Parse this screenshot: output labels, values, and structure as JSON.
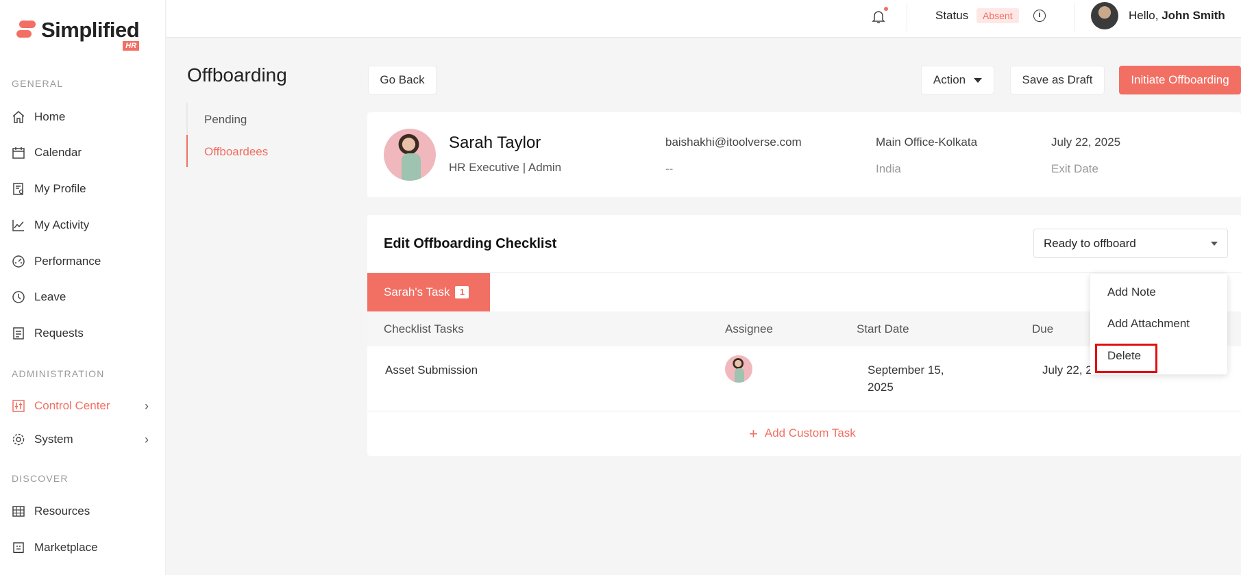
{
  "brand": {
    "name": "Simplified",
    "badge": "HR"
  },
  "sidebar": {
    "sections": {
      "general": "GENERAL",
      "administration": "ADMINISTRATION",
      "discover": "DISCOVER"
    },
    "items": [
      {
        "label": "Home",
        "icon": "home-icon"
      },
      {
        "label": "Calendar",
        "icon": "calendar-icon"
      },
      {
        "label": "My Profile",
        "icon": "profile-icon"
      },
      {
        "label": "My Activity",
        "icon": "activity-chart-icon"
      },
      {
        "label": "Performance",
        "icon": "gauge-icon"
      },
      {
        "label": "Leave",
        "icon": "clock-icon"
      },
      {
        "label": "Requests",
        "icon": "requests-icon"
      },
      {
        "label": "Control Center",
        "icon": "sliders-icon"
      },
      {
        "label": "System",
        "icon": "gear-icon"
      },
      {
        "label": "Resources",
        "icon": "table-icon"
      },
      {
        "label": "Marketplace",
        "icon": "store-icon"
      }
    ]
  },
  "header": {
    "status_label": "Status",
    "status_value": "Absent",
    "greeting": "Hello,",
    "user_name": "John Smith"
  },
  "page": {
    "title": "Offboarding",
    "subnav": [
      "Pending",
      "Offboardees"
    ]
  },
  "actions": {
    "go_back": "Go Back",
    "action": "Action",
    "save_draft": "Save as Draft",
    "initiate": "Initiate Offboarding"
  },
  "employee": {
    "name": "Sarah Taylor",
    "role": "HR Executive | Admin",
    "email": "baishakhi@itoolverse.com",
    "phone": "--",
    "office": "Main Office-Kolkata",
    "country": "India",
    "exit_date": "July 22, 2025",
    "exit_date_label": "Exit Date"
  },
  "checklist": {
    "title": "Edit Offboarding Checklist",
    "status_select": "Ready to offboard",
    "tab_label": "Sarah's Task",
    "tab_count": "1",
    "columns": [
      "Checklist Tasks",
      "Assignee",
      "Start Date",
      "Due"
    ],
    "rows": [
      {
        "task": "Asset Submission",
        "start_line1": "September 15,",
        "start_line2": "2025",
        "due": "July 22, 2"
      }
    ],
    "add_task": "Add Custom Task"
  },
  "context_menu": [
    "Add Note",
    "Add Attachment",
    "Delete"
  ],
  "colors": {
    "accent": "#f26f63",
    "highlight": "#e01010"
  }
}
